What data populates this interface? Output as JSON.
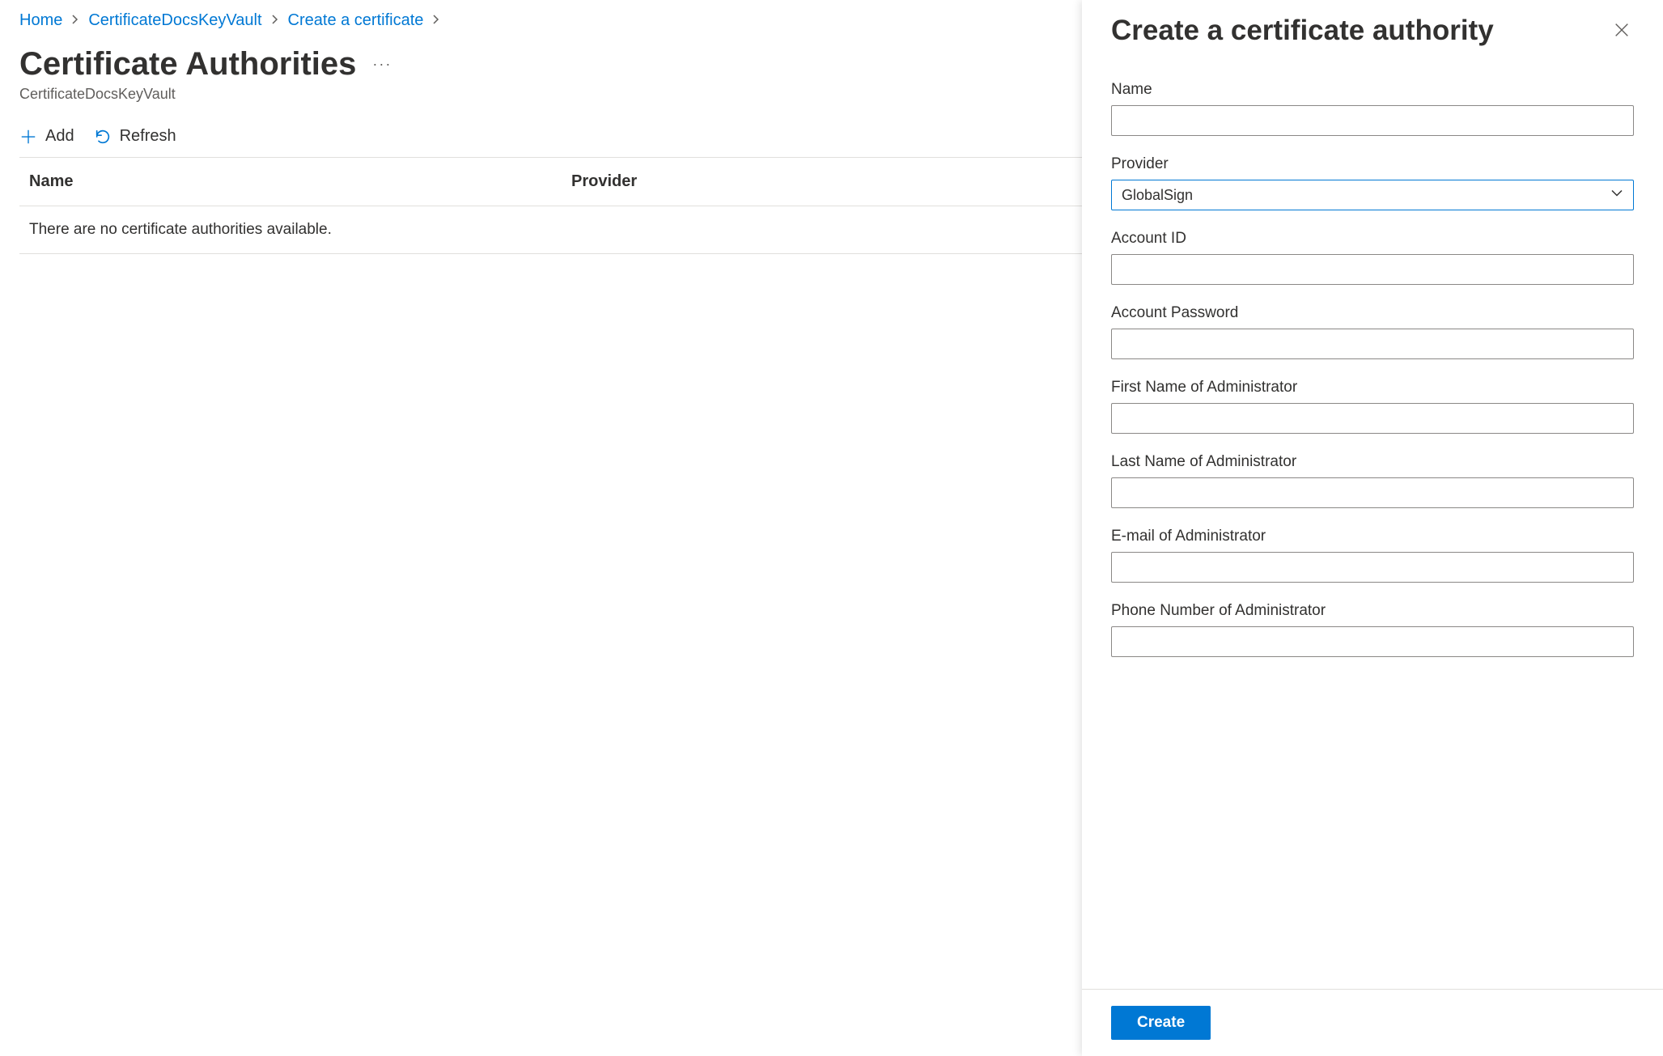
{
  "breadcrumb": {
    "items": [
      {
        "label": "Home"
      },
      {
        "label": "CertificateDocsKeyVault"
      },
      {
        "label": "Create a certificate"
      }
    ]
  },
  "page": {
    "title": "Certificate Authorities",
    "subtitle": "CertificateDocsKeyVault"
  },
  "toolbar": {
    "add": "Add",
    "refresh": "Refresh"
  },
  "table": {
    "headers": {
      "name": "Name",
      "provider": "Provider"
    },
    "empty": "There are no certificate authorities available."
  },
  "panel": {
    "title": "Create a certificate authority",
    "form": {
      "name_label": "Name",
      "name_value": "",
      "provider_label": "Provider",
      "provider_value": "GlobalSign",
      "accountid_label": "Account ID",
      "accountid_value": "",
      "password_label": "Account Password",
      "password_value": "",
      "firstname_label": "First Name of Administrator",
      "firstname_value": "",
      "lastname_label": "Last Name of Administrator",
      "lastname_value": "",
      "email_label": "E-mail of Administrator",
      "email_value": "",
      "phone_label": "Phone Number of Administrator",
      "phone_value": ""
    },
    "footer": {
      "create": "Create"
    }
  }
}
